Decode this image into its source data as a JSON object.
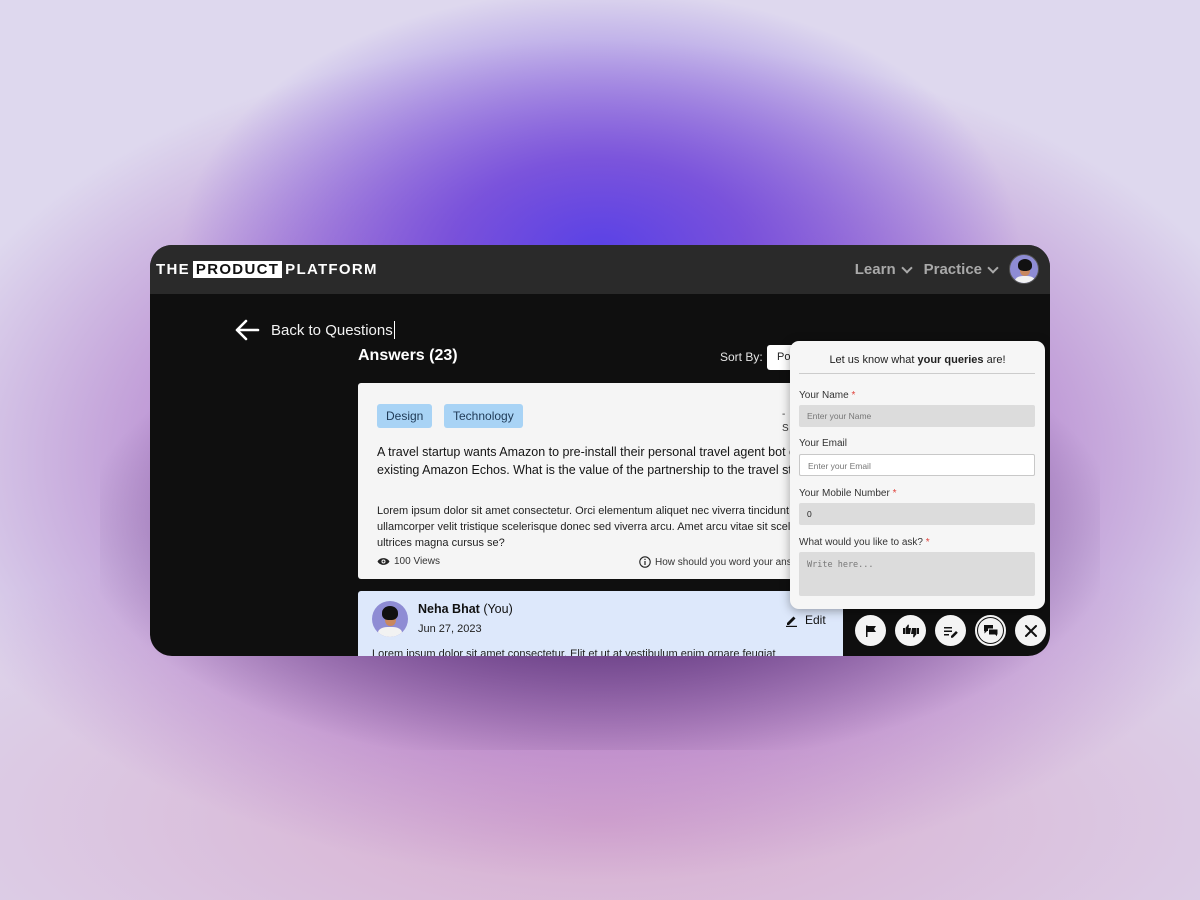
{
  "header": {
    "logo_pre": "THE",
    "logo_box": "PRODUCT",
    "logo_post": "PLATFORM",
    "nav": [
      {
        "label": "Learn",
        "icon": "chevron-down-icon"
      },
      {
        "label": "Practice",
        "icon": "chevron-down-icon"
      }
    ],
    "avatar_icon": "user-avatar"
  },
  "back": {
    "label": "Back to Questions",
    "icon": "arrow-left-icon"
  },
  "answers": {
    "title": "Answers (23)",
    "sort_label": "Sort By:",
    "sort_value": "Po"
  },
  "question": {
    "tags": [
      "Design",
      "Technology"
    ],
    "title": "A travel startup wants Amazon to pre-install their personal travel agent bot on existing Amazon Echos. What is the value of the partnership to the travel startup?",
    "body": "Lorem ipsum dolor sit amet consectetur. Orci elementum aliquet nec viverra tincidunt ? Amet ullamcorper velit tristique scelerisque donec sed viverra arcu. Amet arcu vitae sit scelerisque ultrices magna cursus se?",
    "views": "100 Views",
    "help": "How should you word your answer?",
    "side_top": "-",
    "side_bottom": "S"
  },
  "answer": {
    "name": "Neha Bhat",
    "you": "(You)",
    "date": "Jun 27, 2023",
    "edit_label": "Edit",
    "body": "Lorem ipsum dolor sit amet consectetur. Elit et ut at vestibulum enim ornare feugiat"
  },
  "form": {
    "title_pre": "Let us know what ",
    "title_bold": "your queries",
    "title_post": " are!",
    "name_label": "Your Name",
    "name_placeholder": "Enter your Name",
    "email_label": "Your Email",
    "email_placeholder": "Enter your Email",
    "mobile_label": "Your Mobile Number",
    "mobile_value": "0",
    "ask_label": "What would you like to ask?",
    "ask_placeholder": "Write here...",
    "required_mark": "*"
  },
  "fabs": [
    {
      "name": "flag-icon"
    },
    {
      "name": "thumbs-up-down-icon"
    },
    {
      "name": "edit-list-icon"
    },
    {
      "name": "chat-bubbles-icon"
    },
    {
      "name": "close-icon"
    }
  ]
}
